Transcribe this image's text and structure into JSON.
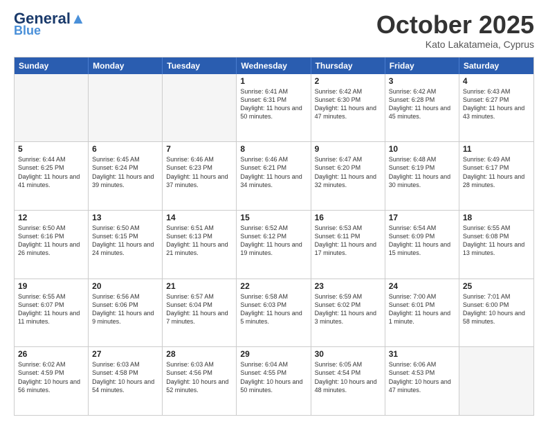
{
  "header": {
    "logo_line1": "General",
    "logo_line2": "Blue",
    "month": "October 2025",
    "location": "Kato Lakatameia, Cyprus"
  },
  "days_of_week": [
    "Sunday",
    "Monday",
    "Tuesday",
    "Wednesday",
    "Thursday",
    "Friday",
    "Saturday"
  ],
  "weeks": [
    [
      {
        "day": "",
        "info": ""
      },
      {
        "day": "",
        "info": ""
      },
      {
        "day": "",
        "info": ""
      },
      {
        "day": "1",
        "info": "Sunrise: 6:41 AM\nSunset: 6:31 PM\nDaylight: 11 hours\nand 50 minutes."
      },
      {
        "day": "2",
        "info": "Sunrise: 6:42 AM\nSunset: 6:30 PM\nDaylight: 11 hours\nand 47 minutes."
      },
      {
        "day": "3",
        "info": "Sunrise: 6:42 AM\nSunset: 6:28 PM\nDaylight: 11 hours\nand 45 minutes."
      },
      {
        "day": "4",
        "info": "Sunrise: 6:43 AM\nSunset: 6:27 PM\nDaylight: 11 hours\nand 43 minutes."
      }
    ],
    [
      {
        "day": "5",
        "info": "Sunrise: 6:44 AM\nSunset: 6:25 PM\nDaylight: 11 hours\nand 41 minutes."
      },
      {
        "day": "6",
        "info": "Sunrise: 6:45 AM\nSunset: 6:24 PM\nDaylight: 11 hours\nand 39 minutes."
      },
      {
        "day": "7",
        "info": "Sunrise: 6:46 AM\nSunset: 6:23 PM\nDaylight: 11 hours\nand 37 minutes."
      },
      {
        "day": "8",
        "info": "Sunrise: 6:46 AM\nSunset: 6:21 PM\nDaylight: 11 hours\nand 34 minutes."
      },
      {
        "day": "9",
        "info": "Sunrise: 6:47 AM\nSunset: 6:20 PM\nDaylight: 11 hours\nand 32 minutes."
      },
      {
        "day": "10",
        "info": "Sunrise: 6:48 AM\nSunset: 6:19 PM\nDaylight: 11 hours\nand 30 minutes."
      },
      {
        "day": "11",
        "info": "Sunrise: 6:49 AM\nSunset: 6:17 PM\nDaylight: 11 hours\nand 28 minutes."
      }
    ],
    [
      {
        "day": "12",
        "info": "Sunrise: 6:50 AM\nSunset: 6:16 PM\nDaylight: 11 hours\nand 26 minutes."
      },
      {
        "day": "13",
        "info": "Sunrise: 6:50 AM\nSunset: 6:15 PM\nDaylight: 11 hours\nand 24 minutes."
      },
      {
        "day": "14",
        "info": "Sunrise: 6:51 AM\nSunset: 6:13 PM\nDaylight: 11 hours\nand 21 minutes."
      },
      {
        "day": "15",
        "info": "Sunrise: 6:52 AM\nSunset: 6:12 PM\nDaylight: 11 hours\nand 19 minutes."
      },
      {
        "day": "16",
        "info": "Sunrise: 6:53 AM\nSunset: 6:11 PM\nDaylight: 11 hours\nand 17 minutes."
      },
      {
        "day": "17",
        "info": "Sunrise: 6:54 AM\nSunset: 6:09 PM\nDaylight: 11 hours\nand 15 minutes."
      },
      {
        "day": "18",
        "info": "Sunrise: 6:55 AM\nSunset: 6:08 PM\nDaylight: 11 hours\nand 13 minutes."
      }
    ],
    [
      {
        "day": "19",
        "info": "Sunrise: 6:55 AM\nSunset: 6:07 PM\nDaylight: 11 hours\nand 11 minutes."
      },
      {
        "day": "20",
        "info": "Sunrise: 6:56 AM\nSunset: 6:06 PM\nDaylight: 11 hours\nand 9 minutes."
      },
      {
        "day": "21",
        "info": "Sunrise: 6:57 AM\nSunset: 6:04 PM\nDaylight: 11 hours\nand 7 minutes."
      },
      {
        "day": "22",
        "info": "Sunrise: 6:58 AM\nSunset: 6:03 PM\nDaylight: 11 hours\nand 5 minutes."
      },
      {
        "day": "23",
        "info": "Sunrise: 6:59 AM\nSunset: 6:02 PM\nDaylight: 11 hours\nand 3 minutes."
      },
      {
        "day": "24",
        "info": "Sunrise: 7:00 AM\nSunset: 6:01 PM\nDaylight: 11 hours\nand 1 minute."
      },
      {
        "day": "25",
        "info": "Sunrise: 7:01 AM\nSunset: 6:00 PM\nDaylight: 10 hours\nand 58 minutes."
      }
    ],
    [
      {
        "day": "26",
        "info": "Sunrise: 6:02 AM\nSunset: 4:59 PM\nDaylight: 10 hours\nand 56 minutes."
      },
      {
        "day": "27",
        "info": "Sunrise: 6:03 AM\nSunset: 4:58 PM\nDaylight: 10 hours\nand 54 minutes."
      },
      {
        "day": "28",
        "info": "Sunrise: 6:03 AM\nSunset: 4:56 PM\nDaylight: 10 hours\nand 52 minutes."
      },
      {
        "day": "29",
        "info": "Sunrise: 6:04 AM\nSunset: 4:55 PM\nDaylight: 10 hours\nand 50 minutes."
      },
      {
        "day": "30",
        "info": "Sunrise: 6:05 AM\nSunset: 4:54 PM\nDaylight: 10 hours\nand 48 minutes."
      },
      {
        "day": "31",
        "info": "Sunrise: 6:06 AM\nSunset: 4:53 PM\nDaylight: 10 hours\nand 47 minutes."
      },
      {
        "day": "",
        "info": ""
      }
    ]
  ]
}
